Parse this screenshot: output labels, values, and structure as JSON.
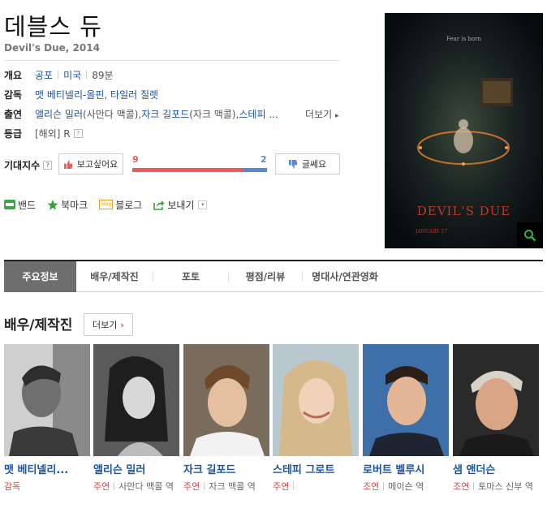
{
  "movie": {
    "title": "데블스 듀",
    "subtitle": "Devil's Due, 2014"
  },
  "info": {
    "overview_label": "개요",
    "genre": "공포",
    "country": "미국",
    "runtime": "89분",
    "director_label": "감독",
    "directors": "맷 베티넬리-올핀, 타일러 질렛",
    "cast_label": "출연",
    "cast_1_name": "앨리슨 밀러",
    "cast_1_role": "(사만다 맥콜), ",
    "cast_2_name": "자크 길포드",
    "cast_2_role": "(자크 맥콜), ",
    "cast_3_name": "스테피 ...",
    "more_link": "더보기",
    "rating_label": "등급",
    "rating_value": "[해외] R"
  },
  "expect": {
    "label": "기대지수",
    "want_button": "보고싶어요",
    "no_button": "글쎄요",
    "want_count": "9",
    "no_count": "2",
    "want_fraction": 0.82
  },
  "share": {
    "band": "밴드",
    "bookmark": "북마크",
    "blog": "블로그",
    "blog_icon_text": "blog",
    "send": "보내기"
  },
  "poster": {
    "tagline": "Fear is born",
    "title": "DEVIL'S DUE",
    "date": "JANUARY 17"
  },
  "tabs": [
    {
      "label": "주요정보"
    },
    {
      "label": "배우/제작진"
    },
    {
      "label": "포토"
    },
    {
      "label": "평점/리뷰"
    },
    {
      "label": "명대사/연관영화"
    }
  ],
  "section": {
    "title": "배우/제작진",
    "more": "더보기"
  },
  "people": [
    {
      "name": "맷 베티넬리...",
      "type": "감독",
      "role": ""
    },
    {
      "name": "앨리슨 밀러",
      "type": "주연",
      "role": "사만다 맥콜 역"
    },
    {
      "name": "자크 길포드",
      "type": "주연",
      "role": "자크 맥콜 역"
    },
    {
      "name": "스테피 그로트",
      "type": "주연",
      "role": ""
    },
    {
      "name": "로버트 벨루시",
      "type": "조연",
      "role": "메이슨 역"
    },
    {
      "name": "샘 앤더슨",
      "type": "조연",
      "role": "토마스 신부 역"
    }
  ],
  "colors": {
    "link": "#1a54a8",
    "want": "#ee5a5a",
    "no": "#5b86d8",
    "active_tab": "#6e6e6e"
  }
}
